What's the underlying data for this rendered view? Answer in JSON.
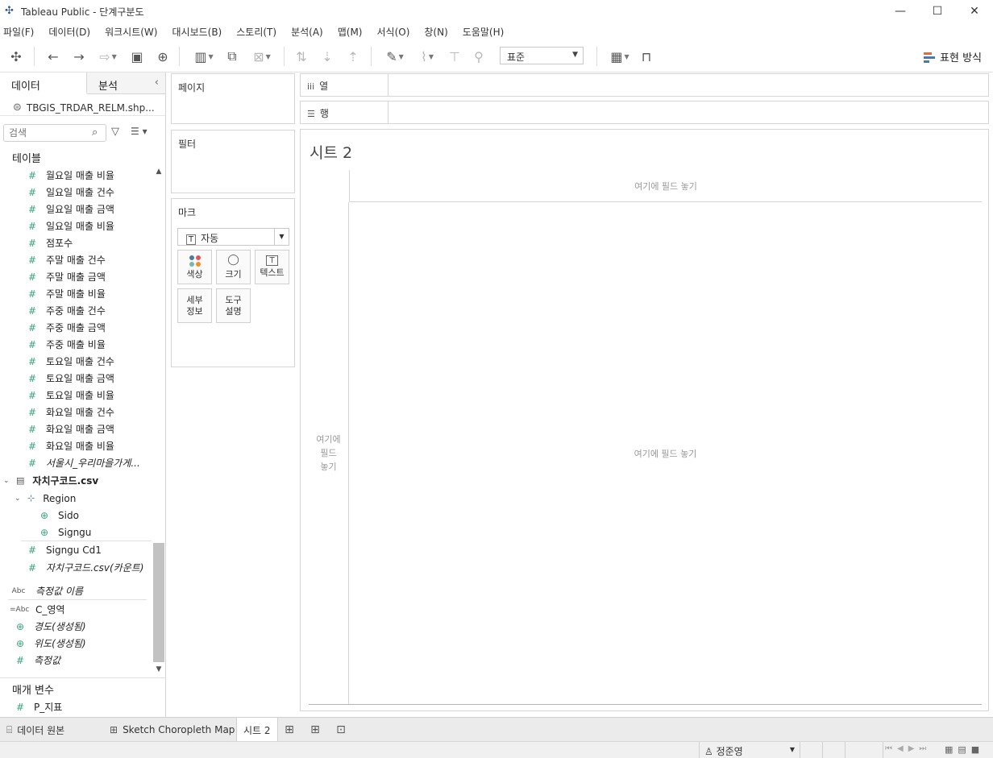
{
  "window": {
    "title": "Tableau Public - 단계구분도",
    "app_icon": "tableau-icon",
    "minimize": "—",
    "maximize": "☐",
    "close": "✕"
  },
  "menu": [
    "파일(F)",
    "데이터(D)",
    "워크시트(W)",
    "대시보드(B)",
    "스토리(T)",
    "분석(A)",
    "맵(M)",
    "서식(O)",
    "창(N)",
    "도움말(H)"
  ],
  "toolbar": {
    "fit_select": "표준",
    "show_me_label": "표현 방식"
  },
  "left_pane": {
    "tab_data": "데이터",
    "tab_analysis": "분석",
    "collapse": "‹",
    "datasource": "TBGIS_TRDAR_RELM.shp...",
    "search_placeholder": "검색",
    "tables_title": "테이블",
    "fields": [
      {
        "label": "월요일 매출 비율",
        "icon": "#",
        "italic": false
      },
      {
        "label": "일요일 매출 건수",
        "icon": "#",
        "italic": false
      },
      {
        "label": "일요일 매출 금액",
        "icon": "#",
        "italic": false
      },
      {
        "label": "일요일 매출 비율",
        "icon": "#",
        "italic": false
      },
      {
        "label": "점포수",
        "icon": "#",
        "italic": false
      },
      {
        "label": "주말 매출 건수",
        "icon": "#",
        "italic": false
      },
      {
        "label": "주말 매출 금액",
        "icon": "#",
        "italic": false
      },
      {
        "label": "주말 매출 비율",
        "icon": "#",
        "italic": false
      },
      {
        "label": "주중 매출 건수",
        "icon": "#",
        "italic": false
      },
      {
        "label": "주중 매출 금액",
        "icon": "#",
        "italic": false
      },
      {
        "label": "주중 매출 비율",
        "icon": "#",
        "italic": false
      },
      {
        "label": "토요일 매출 건수",
        "icon": "#",
        "italic": false
      },
      {
        "label": "토요일 매출 금액",
        "icon": "#",
        "italic": false
      },
      {
        "label": "토요일 매출 비율",
        "icon": "#",
        "italic": false
      },
      {
        "label": "화요일 매출 건수",
        "icon": "#",
        "italic": false
      },
      {
        "label": "화요일 매출 금액",
        "icon": "#",
        "italic": false
      },
      {
        "label": "화요일 매출 비율",
        "icon": "#",
        "italic": false
      },
      {
        "label": "서울시_우리마을가게...",
        "icon": "#",
        "italic": true
      }
    ],
    "table2": {
      "name": "자치구코드.csv",
      "hierarchy": "Region",
      "hier_children": [
        "Sido",
        "Signgu"
      ],
      "fields": [
        {
          "label": "Signgu Cd1",
          "icon": "#",
          "italic": false
        },
        {
          "label": "자치구코드.csv(카운트)",
          "icon": "#",
          "italic": true
        }
      ]
    },
    "extra_fields": [
      {
        "label": "측정값 이름",
        "icon": "Abc",
        "italic": true
      },
      {
        "label": "C_영역",
        "icon": "=Abc",
        "italic": false
      },
      {
        "label": "경도(생성됨)",
        "icon": "globe",
        "italic": true
      },
      {
        "label": "위도(생성됨)",
        "icon": "globe",
        "italic": true
      },
      {
        "label": "측정값",
        "icon": "#",
        "italic": true
      }
    ],
    "params_title": "매개 변수",
    "params": [
      {
        "label": "P_지표",
        "icon": "#"
      }
    ]
  },
  "cards": {
    "pages": "페이지",
    "filters": "필터",
    "marks": "마크",
    "marks_type": "자동",
    "mark_buttons": [
      "색상",
      "크기",
      "텍스트"
    ],
    "mark_detail": [
      "세부",
      "정보"
    ],
    "mark_tooltip": [
      "도구",
      "설명"
    ]
  },
  "shelves": {
    "columns": "열",
    "rows": "행"
  },
  "canvas": {
    "sheet_title": "시트 2",
    "col_drop": "여기에 필드 놓기",
    "row_drop": [
      "여기에",
      "필드",
      "놓기"
    ],
    "body_drop": "여기에 필드 놓기"
  },
  "sheet_tabs": {
    "datasource_tab": "데이터 원본",
    "sheet1": "Sketch Choropleth Map",
    "sheet2": "시트 2"
  },
  "status": {
    "user": "정준영"
  }
}
